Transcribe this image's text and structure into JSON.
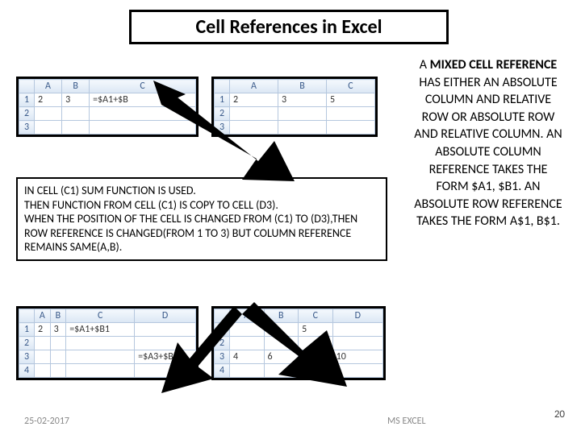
{
  "title": "Cell References in Excel",
  "grids": {
    "top_left": {
      "cols": [
        "A",
        "B",
        "C"
      ],
      "rows": [
        {
          "n": "1",
          "cells": [
            "2",
            "3",
            "=$A1+$B"
          ]
        },
        {
          "n": "2",
          "cells": [
            "",
            "",
            ""
          ]
        },
        {
          "n": "3",
          "cells": [
            "",
            "",
            ""
          ]
        }
      ]
    },
    "top_right": {
      "cols": [
        "A",
        "B",
        "C"
      ],
      "rows": [
        {
          "n": "1",
          "cells": [
            "2",
            "3",
            "5"
          ]
        },
        {
          "n": "2",
          "cells": [
            "",
            "",
            ""
          ]
        },
        {
          "n": "3",
          "cells": [
            "",
            "",
            ""
          ]
        }
      ]
    },
    "bottom_left": {
      "cols": [
        "A",
        "B",
        "C",
        "D"
      ],
      "rows": [
        {
          "n": "1",
          "cells": [
            "2",
            "3",
            "=$A1+$B1",
            ""
          ]
        },
        {
          "n": "2",
          "cells": [
            "",
            "",
            "",
            ""
          ]
        },
        {
          "n": "3",
          "cells": [
            "",
            "",
            "",
            "=$A3+$B"
          ]
        },
        {
          "n": "4",
          "cells": [
            "",
            "",
            "",
            ""
          ]
        }
      ]
    },
    "bottom_right": {
      "cols": [
        "A",
        "B",
        "C",
        "D"
      ],
      "rows": [
        {
          "n": "1",
          "cells": [
            "",
            "",
            "5",
            ""
          ]
        },
        {
          "n": "2",
          "cells": [
            "",
            "",
            "",
            ""
          ]
        },
        {
          "n": "3",
          "cells": [
            "4",
            "6",
            "",
            "10"
          ]
        },
        {
          "n": "4",
          "cells": [
            "",
            "",
            "",
            ""
          ]
        }
      ]
    }
  },
  "explain": {
    "l1": "IN CELL (C1) SUM FUNCTION IS USED.",
    "l2": "THEN FUNCTION FROM CELL (C1) IS COPY TO CELL (D3).",
    "l3": "WHEN THE POSITION OF THE CELL IS CHANGED FROM (C1) TO (D3),THEN ROW REFERENCE IS CHANGED(FROM 1 TO 3) BUT COLUMN REFERENCE REMAINS SAME(A,B)."
  },
  "side": {
    "pre": "A ",
    "bold": "MIXED CELL REFERENCE",
    "rest": " HAS EITHER AN ABSOLUTE COLUMN AND RELATIVE ROW OR ABSOLUTE ROW AND RELATIVE COLUMN. AN ABSOLUTE COLUMN REFERENCE TAKES THE FORM $A1, $B1. AN ABSOLUTE ROW REFERENCE TAKES THE FORM A$1, B$1."
  },
  "footer": {
    "date": "25-02-2017",
    "app": "MS EXCEL",
    "page": "20"
  }
}
